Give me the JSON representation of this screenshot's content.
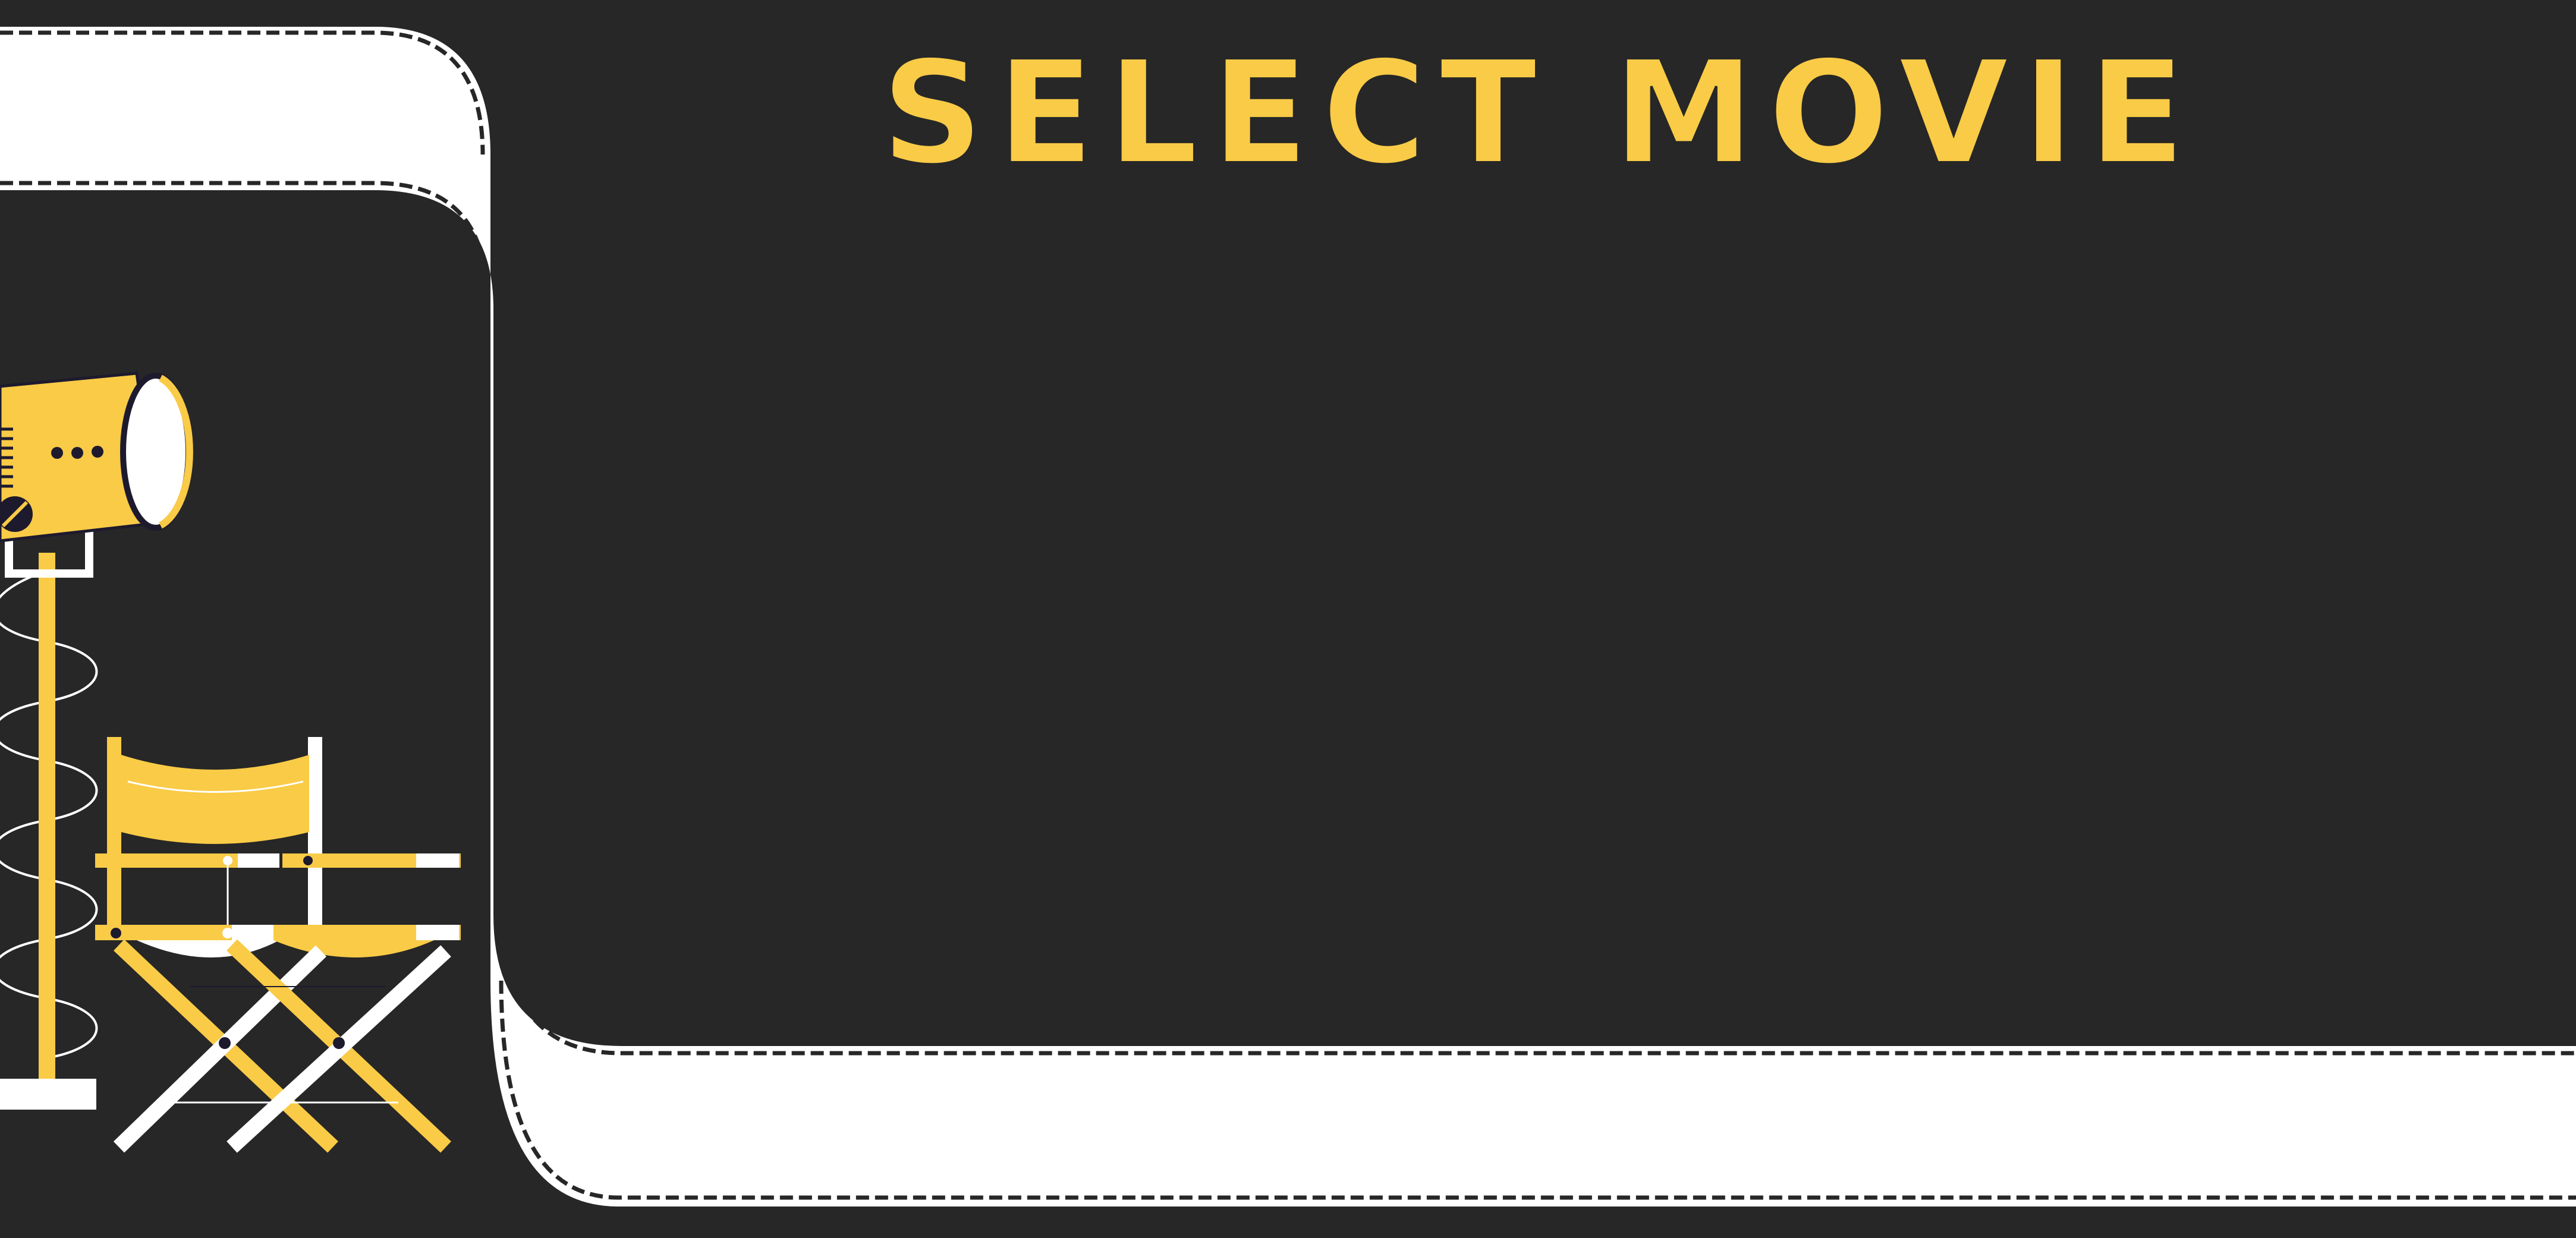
{
  "screen": {
    "title": "SELECT MOVIE"
  },
  "colors": {
    "background": "#272727",
    "accent": "#F9CB46",
    "film_strip": "#FFFFFF",
    "outline": "#1E1A2E"
  },
  "icons": {
    "spotlight": "spotlight-icon",
    "directors_chair": "directors-chair-icon"
  }
}
